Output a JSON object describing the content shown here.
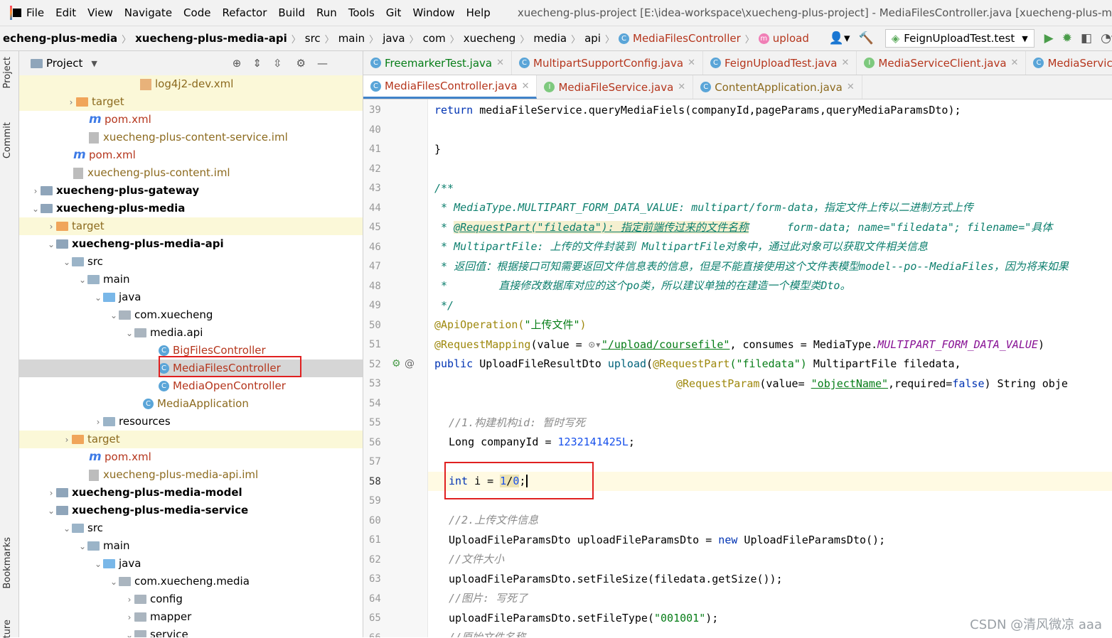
{
  "menubar": {
    "items": [
      "File",
      "Edit",
      "View",
      "Navigate",
      "Code",
      "Refactor",
      "Build",
      "Run",
      "Tools",
      "Git",
      "Window",
      "Help"
    ],
    "title": "xuecheng-plus-project [E:\\idea-workspace\\xuecheng-plus-project] - MediaFilesController.java [xuecheng-plus-m"
  },
  "breadcrumbs": [
    "echeng-plus-media",
    "xuecheng-plus-media-api",
    "src",
    "main",
    "java",
    "com",
    "xuecheng",
    "media",
    "api",
    "MediaFilesController",
    "upload"
  ],
  "run_config": "FeignUploadTest.test",
  "left_strip": {
    "project": "Project",
    "commit": "Commit",
    "bookmarks": "Bookmarks",
    "structure": "ture"
  },
  "project_panel": {
    "title": "Project",
    "tree": [
      {
        "label": "log4j2-dev.xml",
        "type": "xml"
      },
      {
        "label": "target",
        "type": "folder-orange"
      },
      {
        "label": "pom.xml",
        "type": "maven"
      },
      {
        "label": "xuecheng-plus-content-service.iml",
        "type": "iml"
      },
      {
        "label": "pom.xml",
        "type": "maven"
      },
      {
        "label": "xuecheng-plus-content.iml",
        "type": "iml"
      },
      {
        "label": "xuecheng-plus-gateway",
        "type": "module"
      },
      {
        "label": "xuecheng-plus-media",
        "type": "module"
      },
      {
        "label": "target",
        "type": "folder-orange"
      },
      {
        "label": "xuecheng-plus-media-api",
        "type": "module"
      },
      {
        "label": "src",
        "type": "folder"
      },
      {
        "label": "main",
        "type": "folder"
      },
      {
        "label": "java",
        "type": "folder-blue"
      },
      {
        "label": "com.xuecheng",
        "type": "package"
      },
      {
        "label": "media.api",
        "type": "package"
      },
      {
        "label": "BigFilesController",
        "type": "class"
      },
      {
        "label": "MediaFilesController",
        "type": "class"
      },
      {
        "label": "MediaOpenController",
        "type": "class"
      },
      {
        "label": "MediaApplication",
        "type": "class"
      },
      {
        "label": "resources",
        "type": "folder"
      },
      {
        "label": "target",
        "type": "folder-orange"
      },
      {
        "label": "pom.xml",
        "type": "maven"
      },
      {
        "label": "xuecheng-plus-media-api.iml",
        "type": "iml"
      },
      {
        "label": "xuecheng-plus-media-model",
        "type": "module"
      },
      {
        "label": "xuecheng-plus-media-service",
        "type": "module"
      },
      {
        "label": "src",
        "type": "folder"
      },
      {
        "label": "main",
        "type": "folder"
      },
      {
        "label": "java",
        "type": "folder-blue"
      },
      {
        "label": "com.xuecheng.media",
        "type": "package"
      },
      {
        "label": "config",
        "type": "package"
      },
      {
        "label": "mapper",
        "type": "package"
      },
      {
        "label": "service",
        "type": "package"
      }
    ]
  },
  "tabs_row1": [
    "FreemarkerTest.java",
    "MultipartSupportConfig.java",
    "FeignUploadTest.java",
    "MediaServiceClient.java",
    "MediaServic"
  ],
  "tabs_row2": [
    "MediaFilesController.java",
    "MediaFileService.java",
    "ContentApplication.java"
  ],
  "editor": {
    "line_numbers": [
      "39",
      "40",
      "41",
      "42",
      "43",
      "44",
      "45",
      "46",
      "47",
      "48",
      "49",
      "50",
      "51",
      "52",
      "53",
      "54",
      "55",
      "56",
      "57",
      "58",
      "59",
      "60",
      "61",
      "62",
      "63",
      "64",
      "65",
      "66"
    ],
    "lines": {
      "l39": {
        "kw": "return ",
        "rest": "mediaFileService.queryMediaFiels(companyId,pageParams,queryMediaParamsDto);"
      },
      "l41": "}",
      "l43": "/**",
      "l44": " * MediaType.MULTIPART_FORM_DATA_VALUE: multipart/form-data，指定文件上传以二进制方式上传",
      "l45a": "@RequestPart(\"filedata\"): 指定前端传过来的文件名称",
      "l45b": "      form-data; name=\"filedata\"; filename=\"具体",
      "l46": " * MultipartFile: 上传的文件封装到 MultipartFile对象中，通过此对象可以获取文件相关信息",
      "l47": " * 返回值：根据接口可知需要返回文件信息表的信息，但是不能直接使用这个文件表模型model--po--MediaFiles，因为将来如果",
      "l48": " *        直接修改数据库对应的这个po类，所以建议单独的在建造一个模型类Dto。",
      "l49": " */",
      "l50a": "@ApiOperation(",
      "l50b": "\"上传文件\"",
      "l50c": ")",
      "l51a": "@RequestMapping",
      "l51b": "(value = ",
      "l51c": "\"/upload/coursefile\"",
      "l51d": ", consumes = MediaType.",
      "l51e": "MULTIPART_FORM_DATA_VALUE",
      "l51f": ")",
      "l52a": "public ",
      "l52b": "UploadFileResultDto ",
      "l52c": "upload",
      "l52d": "(",
      "l52e": "@RequestPart",
      "l52f": "(\"filedata\")",
      "l52g": " MultipartFile filedata,",
      "l53a": "@RequestParam",
      "l53b": "(value= ",
      "l53c": "\"objectName\"",
      "l53d": ",required=",
      "l53e": "false",
      "l53f": ") String obje",
      "l55": "//1.构建机构id: 暂时写死",
      "l56a": "Long companyId = ",
      "l56b": "1232141425L",
      "l56c": ";",
      "l58a": "int",
      "l58b": " i = ",
      "l58c": "1",
      "l58d": "/",
      "l58e": "0",
      "l58f": ";",
      "l60": "//2.上传文件信息",
      "l61a": "UploadFileParamsDto uploadFileParamsDto = ",
      "l61b": "new ",
      "l61c": "UploadFileParamsDto();",
      "l62": "//文件大小",
      "l63": "uploadFileParamsDto.setFileSize(filedata.getSize());",
      "l64": "//图片: 写死了",
      "l65a": "uploadFileParamsDto.setFileType(",
      "l65b": "\"001001\"",
      "l65c": ");",
      "l66": "//原始文件名称"
    }
  },
  "watermark": "CSDN @清风微凉 aaa"
}
